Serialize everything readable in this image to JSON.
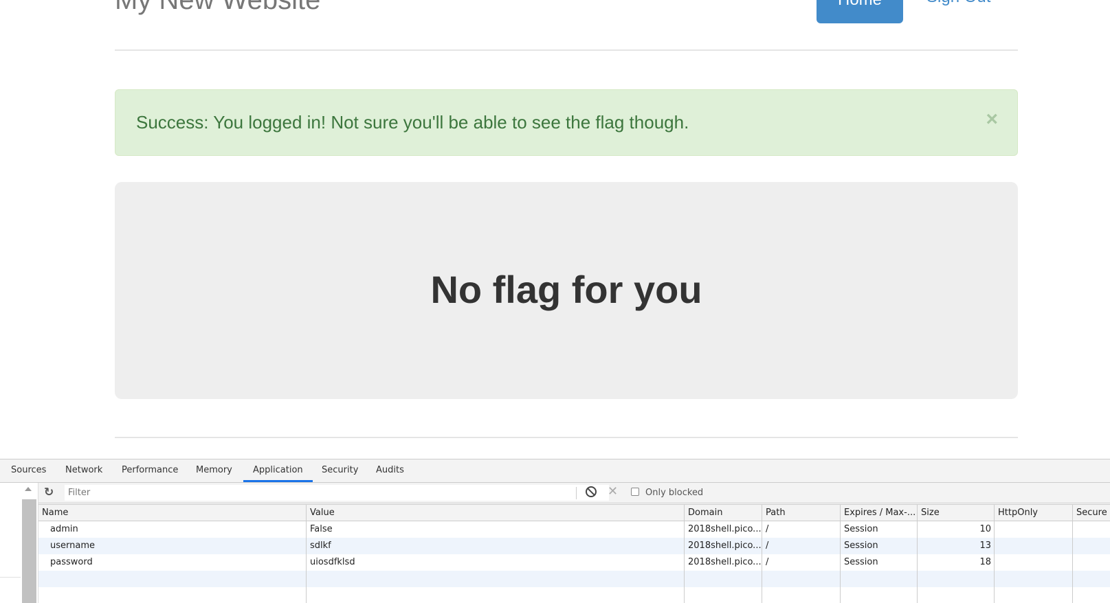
{
  "site": {
    "title": "My New Website",
    "nav": {
      "home": "Home",
      "sign_out": "Sign Out"
    }
  },
  "alert": {
    "message": "Success: You logged in! Not sure you'll be able to see the flag though.",
    "close_glyph": "×"
  },
  "jumbotron": {
    "heading": "No flag for you"
  },
  "devtools": {
    "tabs": [
      {
        "label": "Sources",
        "active": false
      },
      {
        "label": "Network",
        "active": false
      },
      {
        "label": "Performance",
        "active": false
      },
      {
        "label": "Memory",
        "active": false
      },
      {
        "label": "Application",
        "active": true
      },
      {
        "label": "Security",
        "active": false
      },
      {
        "label": "Audits",
        "active": false
      }
    ],
    "toolbar": {
      "refresh_icon": "↻",
      "filter_placeholder": "Filter",
      "filter_value": "",
      "clear_icon": "✕",
      "only_blocked_label": "Only blocked",
      "only_blocked_checked": false
    },
    "cookies": {
      "columns": [
        "Name",
        "Value",
        "Domain",
        "Path",
        "Expires / Max-...",
        "Size",
        "HttpOnly",
        "Secure"
      ],
      "rows": [
        {
          "name": "admin",
          "value": "False",
          "domain": "2018shell.pico...",
          "path": "/",
          "expires": "Session",
          "size": "10",
          "httponly": "",
          "secure": ""
        },
        {
          "name": "username",
          "value": "sdlkf",
          "domain": "2018shell.pico...",
          "path": "/",
          "expires": "Session",
          "size": "13",
          "httponly": "",
          "secure": ""
        },
        {
          "name": "password",
          "value": "uiosdfklsd",
          "domain": "2018shell.pico...",
          "path": "/",
          "expires": "Session",
          "size": "18",
          "httponly": "",
          "secure": ""
        }
      ]
    }
  }
}
